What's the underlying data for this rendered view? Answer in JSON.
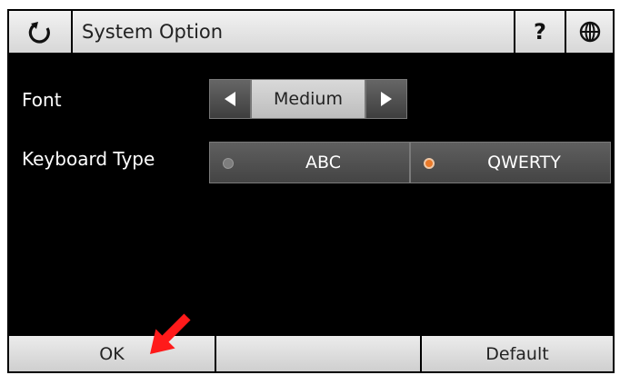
{
  "titlebar": {
    "back_icon": "refresh-back-icon",
    "title": "System Option",
    "help_label": "?",
    "globe_icon": "globe-icon"
  },
  "settings": {
    "font": {
      "label": "Font",
      "value": "Medium"
    },
    "keyboard_type": {
      "label": "Keyboard Type",
      "options": [
        "ABC",
        "QWERTY"
      ],
      "selected": "QWERTY"
    }
  },
  "bottombar": {
    "ok_label": "OK",
    "default_label": "Default"
  },
  "colors": {
    "accent_selected": "#ea7a2a",
    "annotation_arrow": "#ff1a1a"
  }
}
